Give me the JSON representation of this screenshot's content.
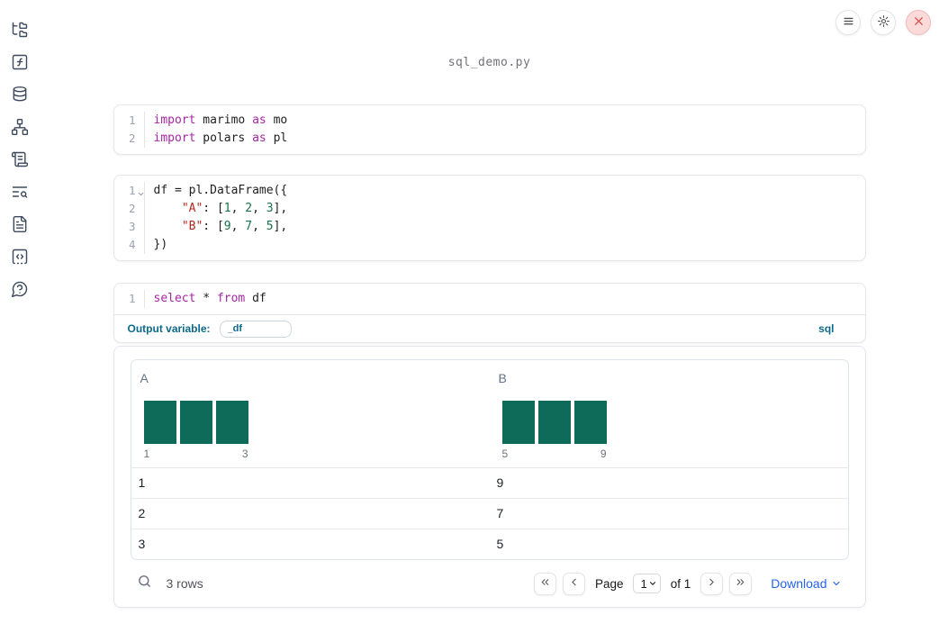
{
  "notebook": {
    "filename": "sql_demo.py"
  },
  "topbar": {
    "buttons": [
      {
        "label": "menu",
        "icon": "hamburger-icon"
      },
      {
        "label": "settings",
        "icon": "gear-icon"
      },
      {
        "label": "shutdown",
        "icon": "close-icon"
      }
    ]
  },
  "sidebar": {
    "items": [
      {
        "label": "file-explorer",
        "icon": "folder-tree-icon"
      },
      {
        "label": "variables",
        "icon": "function-square-icon"
      },
      {
        "label": "data-sources",
        "icon": "database-icon"
      },
      {
        "label": "dependency-graph",
        "icon": "network-icon"
      },
      {
        "label": "scratchpad",
        "icon": "scroll-text-icon"
      },
      {
        "label": "logs",
        "icon": "text-search-icon"
      },
      {
        "label": "documentation",
        "icon": "file-text-icon"
      },
      {
        "label": "snippets",
        "icon": "code-square-icon"
      },
      {
        "label": "help",
        "icon": "help-circle-icon"
      }
    ]
  },
  "cells": [
    {
      "kind": "python",
      "lines": [
        {
          "num": "1",
          "tokens": [
            {
              "t": "import",
              "c": "k"
            },
            {
              "t": " marimo ",
              "c": "p"
            },
            {
              "t": "as",
              "c": "k"
            },
            {
              "t": " mo",
              "c": "p"
            }
          ]
        },
        {
          "num": "2",
          "tokens": [
            {
              "t": "import",
              "c": "k"
            },
            {
              "t": " polars ",
              "c": "p"
            },
            {
              "t": "as",
              "c": "k"
            },
            {
              "t": " pl",
              "c": "p"
            }
          ]
        }
      ]
    },
    {
      "kind": "python",
      "lines": [
        {
          "num": "1",
          "fold": true,
          "tokens": [
            {
              "t": "df = pl.DataFrame({",
              "c": "p"
            }
          ]
        },
        {
          "num": "2",
          "tokens": [
            {
              "t": "    ",
              "c": "p"
            },
            {
              "t": "\"A\"",
              "c": "s"
            },
            {
              "t": ": [",
              "c": "p"
            },
            {
              "t": "1",
              "c": "n"
            },
            {
              "t": ", ",
              "c": "p"
            },
            {
              "t": "2",
              "c": "n"
            },
            {
              "t": ", ",
              "c": "p"
            },
            {
              "t": "3",
              "c": "n"
            },
            {
              "t": "],",
              "c": "p"
            }
          ]
        },
        {
          "num": "3",
          "tokens": [
            {
              "t": "    ",
              "c": "p"
            },
            {
              "t": "\"B\"",
              "c": "s"
            },
            {
              "t": ": [",
              "c": "p"
            },
            {
              "t": "9",
              "c": "n"
            },
            {
              "t": ", ",
              "c": "p"
            },
            {
              "t": "7",
              "c": "n"
            },
            {
              "t": ", ",
              "c": "p"
            },
            {
              "t": "5",
              "c": "n"
            },
            {
              "t": "],",
              "c": "p"
            }
          ]
        },
        {
          "num": "4",
          "tokens": [
            {
              "t": "})",
              "c": "p"
            }
          ]
        }
      ]
    },
    {
      "kind": "sql",
      "lines": [
        {
          "num": "1",
          "tokens": [
            {
              "t": "select",
              "c": "k"
            },
            {
              "t": " * ",
              "c": "p"
            },
            {
              "t": "from",
              "c": "k"
            },
            {
              "t": " df",
              "c": "p"
            }
          ]
        }
      ],
      "footer": {
        "label": "Output variable:",
        "value": "_df",
        "language": "sql"
      }
    }
  ],
  "output": {
    "columns": [
      {
        "label": "A",
        "histogram": {
          "values": [
            1,
            1,
            1
          ],
          "min_label": "1",
          "max_label": "3"
        }
      },
      {
        "label": "B",
        "histogram": {
          "values": [
            1,
            1,
            1
          ],
          "min_label": "5",
          "max_label": "9"
        }
      }
    ],
    "rows": [
      [
        "1",
        "9"
      ],
      [
        "2",
        "7"
      ],
      [
        "3",
        "5"
      ]
    ],
    "footer": {
      "row_count": "3 rows",
      "pagination": {
        "page_label": "Page",
        "current_page": "1",
        "total_label": "of 1"
      },
      "download_label": "Download"
    }
  },
  "colors": {
    "accent_blue": "#0e6a8b",
    "link_blue": "#2563eb",
    "histogram_bar": "#0e6b59",
    "keyword": "#a626a4",
    "string": "#b02a22",
    "number": "#177245"
  }
}
